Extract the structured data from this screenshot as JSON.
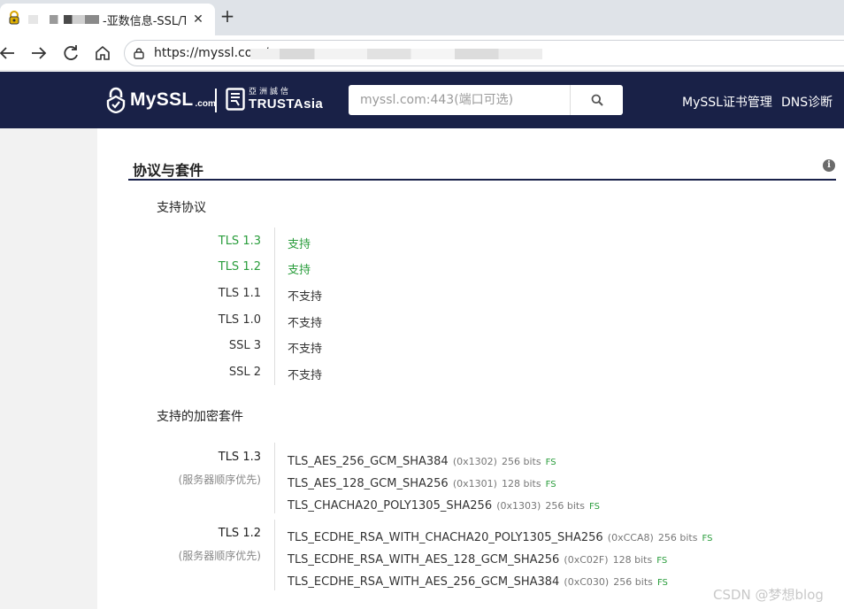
{
  "browser": {
    "tab_title": "-亚数信息-SSL/TLS",
    "tab_close": "✕",
    "new_tab": "+",
    "url": "https://myssl.com/"
  },
  "header": {
    "logo_text": "MySSL",
    "logo_com": ".com",
    "partner_cn": "亞洲誠信",
    "partner_en": "TRUSTAsia",
    "search_placeholder": "myssl.com:443(端口可选)",
    "nav": [
      "MySSL证书管理",
      "DNS诊断"
    ]
  },
  "section": {
    "title": "协议与套件",
    "info_glyph": "i",
    "protocols_title": "支持协议",
    "protocols": [
      {
        "name": "TLS 1.3",
        "status": "支持",
        "supported": true
      },
      {
        "name": "TLS 1.2",
        "status": "支持",
        "supported": true
      },
      {
        "name": "TLS 1.1",
        "status": "不支持",
        "supported": false
      },
      {
        "name": "TLS 1.0",
        "status": "不支持",
        "supported": false
      },
      {
        "name": "SSL 3",
        "status": "不支持",
        "supported": false
      },
      {
        "name": "SSL 2",
        "status": "不支持",
        "supported": false
      }
    ],
    "suites_title": "支持的加密套件",
    "suite_groups": [
      {
        "version": "TLS 1.3",
        "note": "(服务器顺序优先)",
        "suites": [
          {
            "name": "TLS_AES_256_GCM_SHA384",
            "hex": "(0x1302)",
            "bits": "256 bits",
            "fs": "FS"
          },
          {
            "name": "TLS_AES_128_GCM_SHA256",
            "hex": "(0x1301)",
            "bits": "128 bits",
            "fs": "FS"
          },
          {
            "name": "TLS_CHACHA20_POLY1305_SHA256",
            "hex": "(0x1303)",
            "bits": "256 bits",
            "fs": "FS"
          }
        ]
      },
      {
        "version": "TLS 1.2",
        "note": "(服务器顺序优先)",
        "suites": [
          {
            "name": "TLS_ECDHE_RSA_WITH_CHACHA20_POLY1305_SHA256",
            "hex": "(0xCCA8)",
            "bits": "256 bits",
            "fs": "FS"
          },
          {
            "name": "TLS_ECDHE_RSA_WITH_AES_128_GCM_SHA256",
            "hex": "(0xC02F)",
            "bits": "128 bits",
            "fs": "FS"
          },
          {
            "name": "TLS_ECDHE_RSA_WITH_AES_256_GCM_SHA384",
            "hex": "(0xC030)",
            "bits": "256 bits",
            "fs": "FS"
          }
        ]
      }
    ]
  },
  "watermark": "CSDN @梦想blog",
  "colors": {
    "header_bg": "#192147",
    "supported_green": "#2a9d3c"
  }
}
